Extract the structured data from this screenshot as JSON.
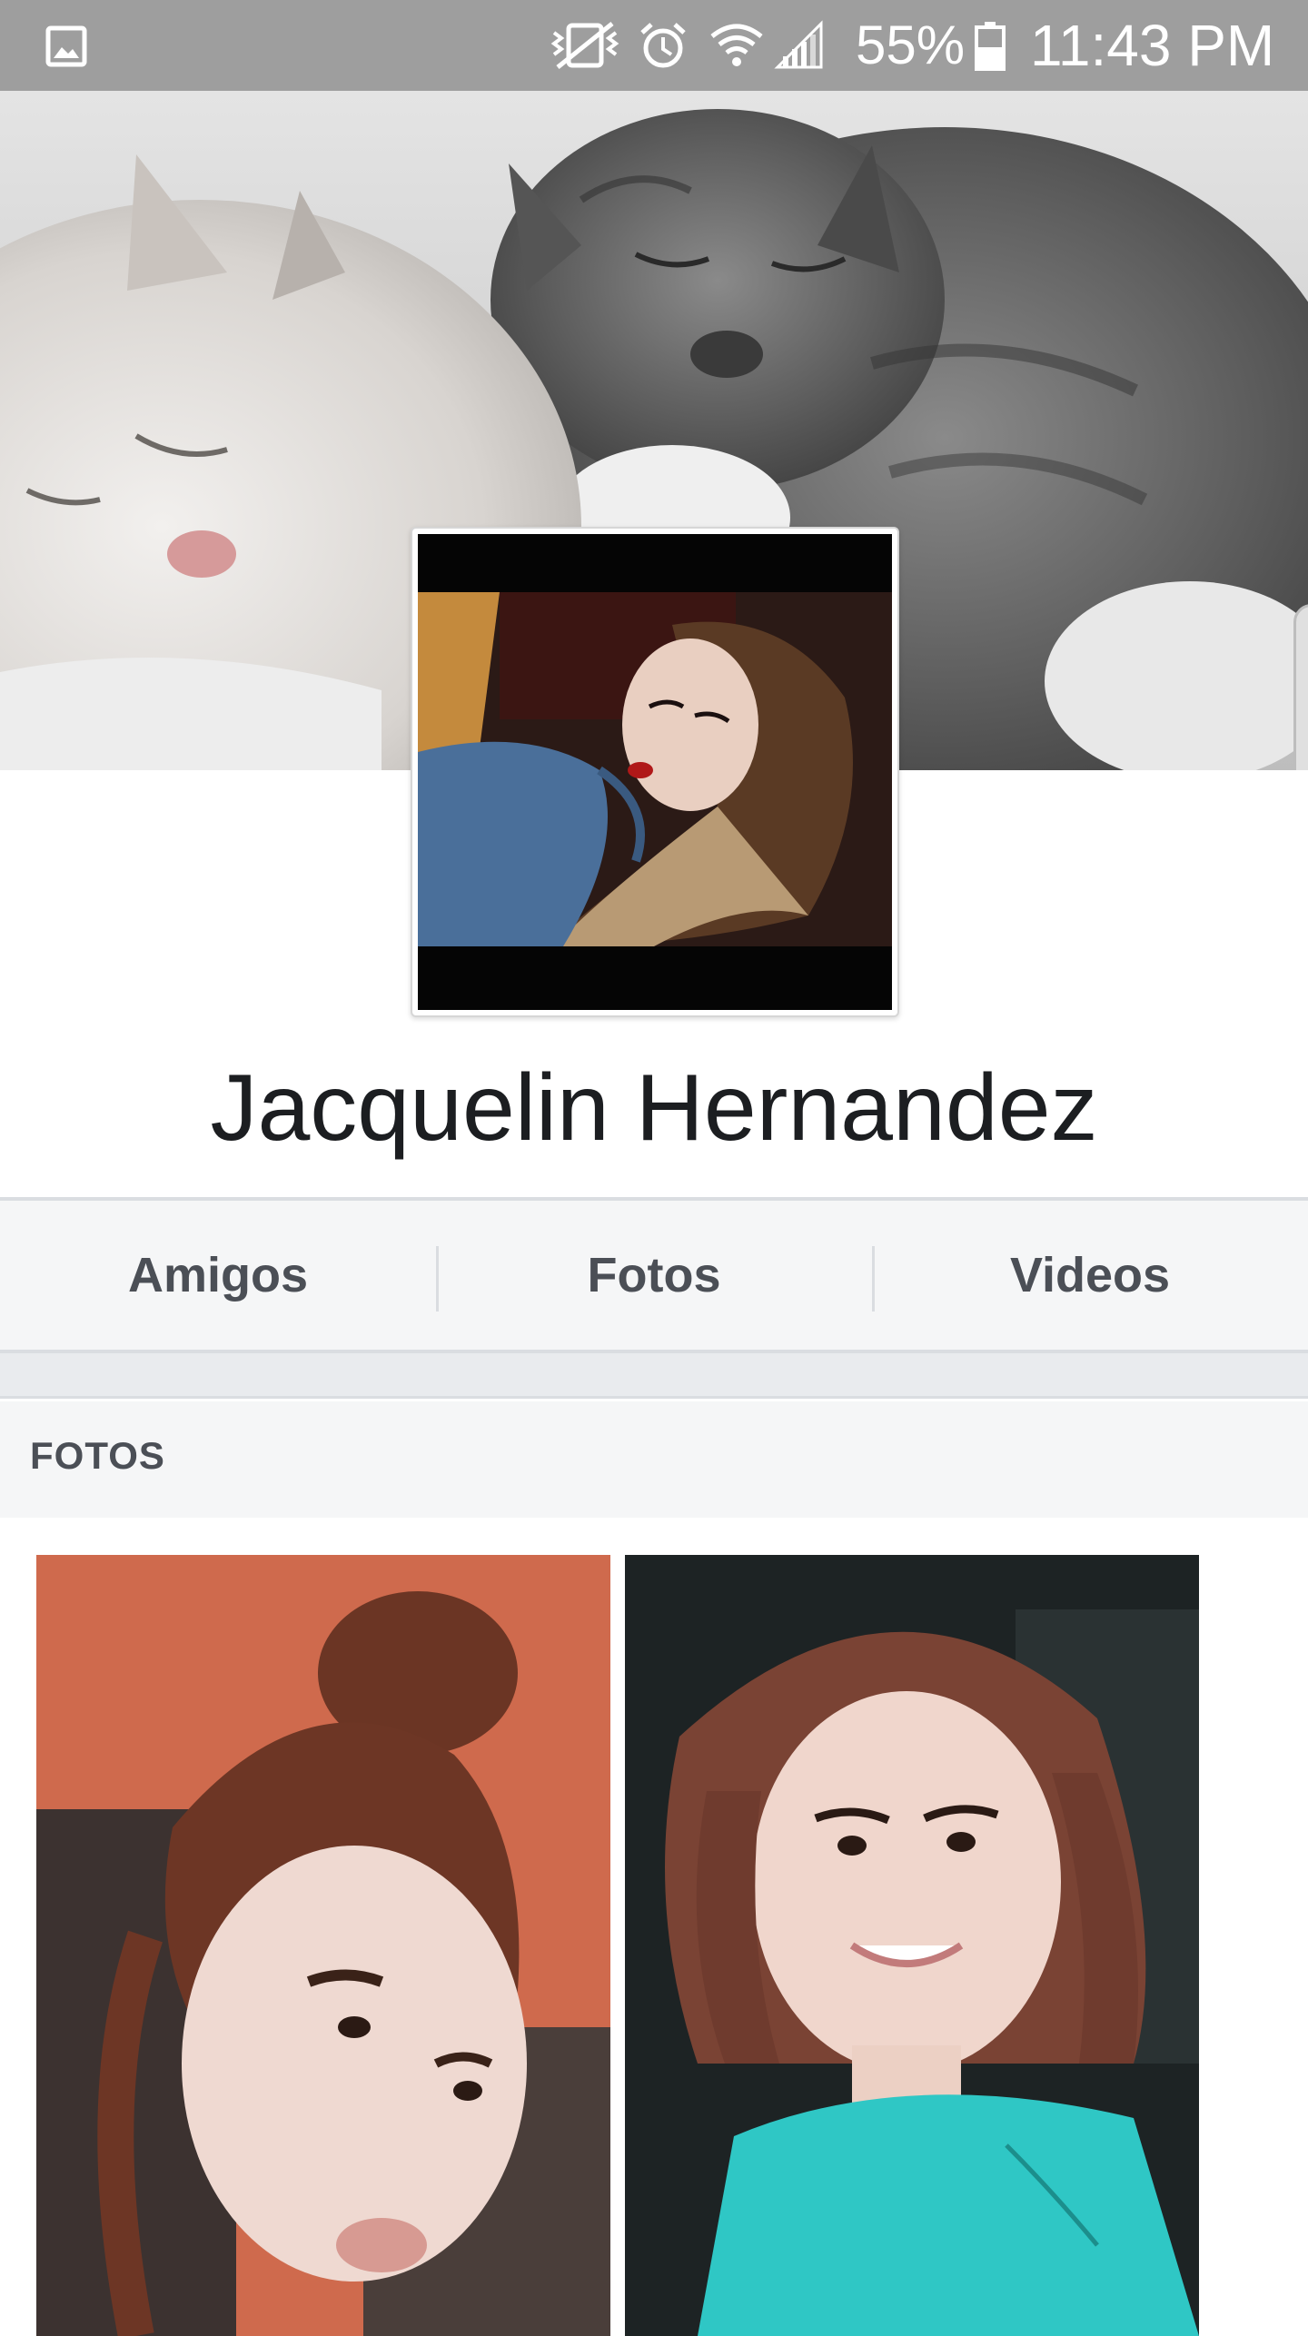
{
  "status_bar": {
    "battery_percent": "55%",
    "time": "11:43 PM",
    "icons": [
      "gallery-icon",
      "mute-vibrate-icon",
      "alarm-icon",
      "wifi-icon",
      "signal-icon",
      "battery-icon"
    ]
  },
  "profile": {
    "name": "Jacquelin Hernandez",
    "cover_photo": "sleeping-kittens",
    "avatar_photo": "profile-picture"
  },
  "tabs": [
    {
      "label": "Amigos"
    },
    {
      "label": "Fotos"
    },
    {
      "label": "Videos"
    }
  ],
  "photos_section": {
    "title": "FOTOS",
    "photos": [
      "photo-1",
      "photo-2"
    ]
  },
  "colors": {
    "status_bar": "#9e9e9e",
    "tab_text": "#4b4f56",
    "tab_background": "#f5f6f7",
    "divider": "#dadde1",
    "name_text": "#1c1e21"
  }
}
